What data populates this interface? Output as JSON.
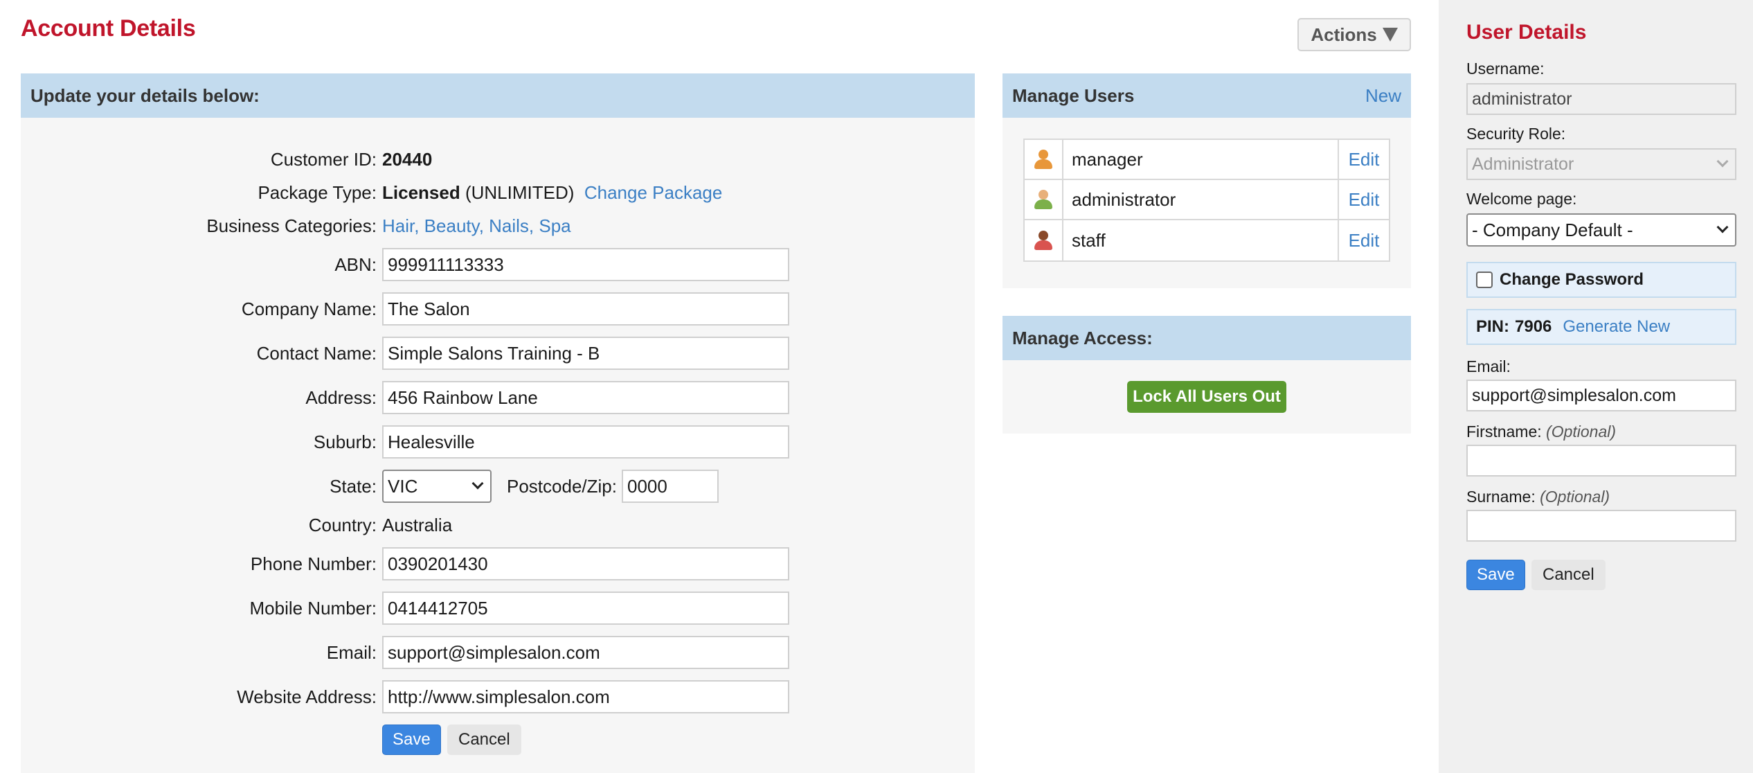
{
  "page": {
    "title": "Account Details",
    "actions_label": "Actions"
  },
  "account_form": {
    "header": "Update your details below:",
    "customer_id": {
      "label": "Customer ID:",
      "value": "20440"
    },
    "package_type": {
      "label": "Package Type:",
      "value_bold": "Licensed",
      "value_rest": "(UNLIMITED)",
      "change_link": "Change Package"
    },
    "business_categories": {
      "label": "Business Categories:",
      "value": "Hair, Beauty, Nails, Spa"
    },
    "abn": {
      "label": "ABN:",
      "value": "999911113333"
    },
    "company_name": {
      "label": "Company Name:",
      "value": "The Salon"
    },
    "contact_name": {
      "label": "Contact Name:",
      "value": "Simple Salons Training - B"
    },
    "address": {
      "label": "Address:",
      "value": "456 Rainbow Lane"
    },
    "suburb": {
      "label": "Suburb:",
      "value": "Healesville"
    },
    "state": {
      "label": "State:",
      "value": "VIC"
    },
    "postcode": {
      "label": "Postcode/Zip:",
      "value": "0000"
    },
    "country": {
      "label": "Country:",
      "value": "Australia"
    },
    "phone": {
      "label": "Phone Number:",
      "value": "0390201430"
    },
    "mobile": {
      "label": "Mobile Number:",
      "value": "0414412705"
    },
    "email": {
      "label": "Email:",
      "value": "support@simplesalon.com"
    },
    "website": {
      "label": "Website Address:",
      "value": "http://www.simplesalon.com"
    },
    "save_label": "Save",
    "cancel_label": "Cancel"
  },
  "manage_users": {
    "header": "Manage Users",
    "new_label": "New",
    "users": [
      {
        "name": "manager",
        "edit": "Edit",
        "icon": "user-orange-icon",
        "color": "#e8973a"
      },
      {
        "name": "administrator",
        "edit": "Edit",
        "icon": "user-green-icon",
        "color": "#7cb04a"
      },
      {
        "name": "staff",
        "edit": "Edit",
        "icon": "user-red-icon",
        "color": "#d9534f"
      }
    ]
  },
  "manage_access": {
    "header": "Manage Access:",
    "lock_label": "Lock All Users Out"
  },
  "user_details": {
    "title": "User Details",
    "username_label": "Username:",
    "username_value": "administrator",
    "role_label": "Security Role:",
    "role_value": "Administrator",
    "welcome_label": "Welcome page:",
    "welcome_value": "- Company Default -",
    "change_password_label": "Change Password",
    "pin_label": "PIN:",
    "pin_value": "7906",
    "generate_label": "Generate New",
    "email_label": "Email:",
    "email_value": "support@simplesalon.com",
    "firstname_label": "Firstname:",
    "surname_label": "Surname:",
    "optional_label": "(Optional)",
    "save_label": "Save",
    "cancel_label": "Cancel"
  },
  "colors": {
    "title_red": "#c0152b",
    "link_blue": "#3b7fc4",
    "header_blue": "#c3dbee",
    "save_blue": "#3b86e0",
    "lock_green": "#5a9a2e"
  }
}
